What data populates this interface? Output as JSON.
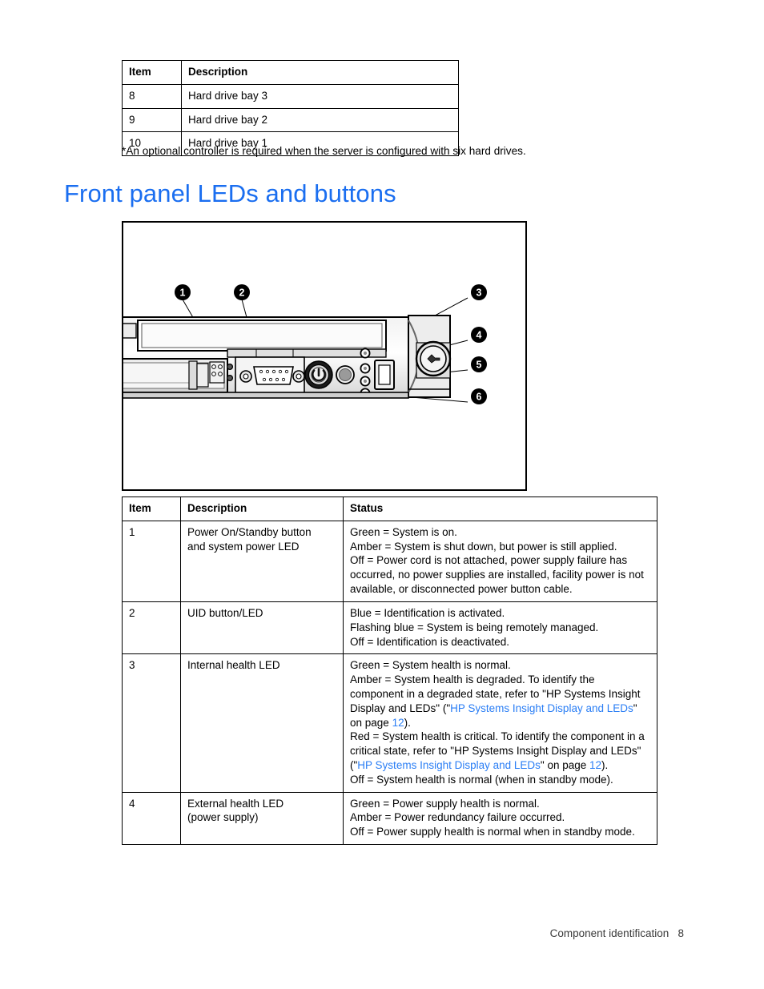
{
  "top_table": {
    "headers": [
      "Item",
      "Description"
    ],
    "rows": [
      [
        "8",
        "Hard drive bay 3"
      ],
      [
        "9",
        "Hard drive bay 2"
      ],
      [
        "10",
        "Hard drive bay 1"
      ]
    ]
  },
  "footnote": "*An optional controller is required when the server is configured with six hard drives.",
  "heading": "Front panel LEDs and buttons",
  "figure": {
    "alt": "Front panel of rack server showing callouts 1 through 6",
    "callouts": [
      "1",
      "2",
      "3",
      "4",
      "5",
      "6"
    ],
    "icons": {
      "power": "power-button-icon",
      "vga": "vga-connector-icon",
      "latch": "release-latch-icon",
      "usb": "usb-port-icon"
    }
  },
  "bottom_table": {
    "headers": [
      "Item",
      "Description",
      "Status"
    ],
    "rows": [
      {
        "item": "1",
        "description_lines": [
          "Power On/Standby button",
          "and system power LED"
        ],
        "status_lines": [
          [
            {
              "t": "Green = System is on."
            }
          ],
          [
            {
              "t": "Amber = System is shut down, but power is still applied."
            }
          ],
          [
            {
              "t": "Off = Power cord is not attached, power supply failure has occurred, no power supplies are installed, facility power is not available, or disconnected power button cable."
            }
          ]
        ]
      },
      {
        "item": "2",
        "description_lines": [
          "UID button/LED"
        ],
        "status_lines": [
          [
            {
              "t": "Blue = Identification is activated."
            }
          ],
          [
            {
              "t": "Flashing blue = System is being remotely managed."
            }
          ],
          [
            {
              "t": "Off = Identification is deactivated."
            }
          ]
        ]
      },
      {
        "item": "3",
        "description_lines": [
          "Internal health LED"
        ],
        "status_lines": [
          [
            {
              "t": "Green = System health is normal."
            }
          ],
          [
            {
              "t": "Amber = System health is degraded. To identify the component in a degraded state, refer to \"HP Systems Insight Display and LEDs\" (\""
            },
            {
              "t": "HP Systems Insight Display and LEDs",
              "link": true
            },
            {
              "t": "\" on page "
            },
            {
              "t": "12",
              "link": true
            },
            {
              "t": ")."
            }
          ],
          [
            {
              "t": "Red = System health is critical. To identify the component in a critical state, refer to \"HP Systems Insight Display and LEDs\" (\""
            },
            {
              "t": "HP Systems Insight Display and LEDs",
              "link": true
            },
            {
              "t": "\" on page "
            },
            {
              "t": "12",
              "link": true
            },
            {
              "t": ")."
            }
          ],
          [
            {
              "t": "Off = System health is normal (when in standby mode)."
            }
          ]
        ]
      },
      {
        "item": "4",
        "description_lines": [
          "External health LED",
          "(power supply)"
        ],
        "status_lines": [
          [
            {
              "t": "Green = Power supply health is normal."
            }
          ],
          [
            {
              "t": "Amber = Power redundancy failure occurred."
            }
          ],
          [
            {
              "t": "Off = Power supply health is normal when in standby mode."
            }
          ]
        ]
      }
    ]
  },
  "footer": {
    "label": "Component identification",
    "page": "8"
  },
  "colors": {
    "heading_blue": "#1a6ef0",
    "link_blue": "#2a7ef5",
    "rule": "#000000"
  }
}
